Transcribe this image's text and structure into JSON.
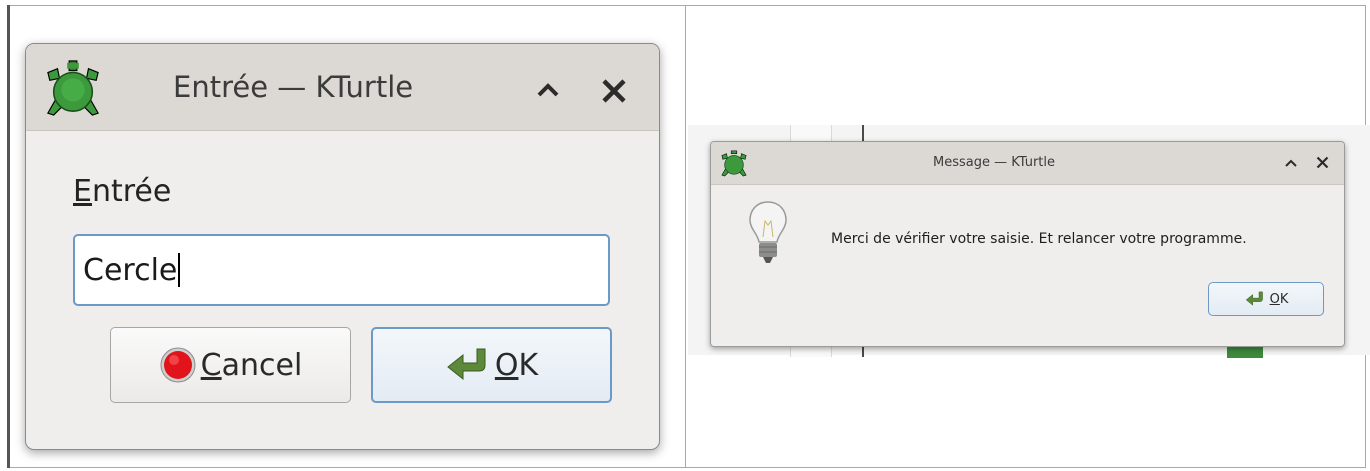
{
  "input_dialog": {
    "title": "Entrée — KTurtle",
    "label_mnemonic": "E",
    "label_rest": "ntrée",
    "input_value": "Cercle",
    "cancel_mnemonic": "C",
    "cancel_rest": "ancel",
    "ok_mnemonic": "O",
    "ok_rest": "K"
  },
  "message_dialog": {
    "title": "Message — KTurtle",
    "message": "Merci de vérifier votre saisie. Et relancer votre programme.",
    "ok_mnemonic": "O",
    "ok_rest": "K"
  },
  "icons": {
    "app": "turtle-icon",
    "minimize": "chevron-up-icon",
    "close": "close-icon",
    "cancel": "stop-icon",
    "ok": "check-arrow-icon",
    "info": "lightbulb-icon"
  },
  "colors": {
    "titlebar": "#dcd9d5",
    "dialog_bg": "#efeeed",
    "focus_border": "#6b99c8",
    "turtle_green": "#3c9a3c",
    "stop_red": "#e0141a"
  }
}
